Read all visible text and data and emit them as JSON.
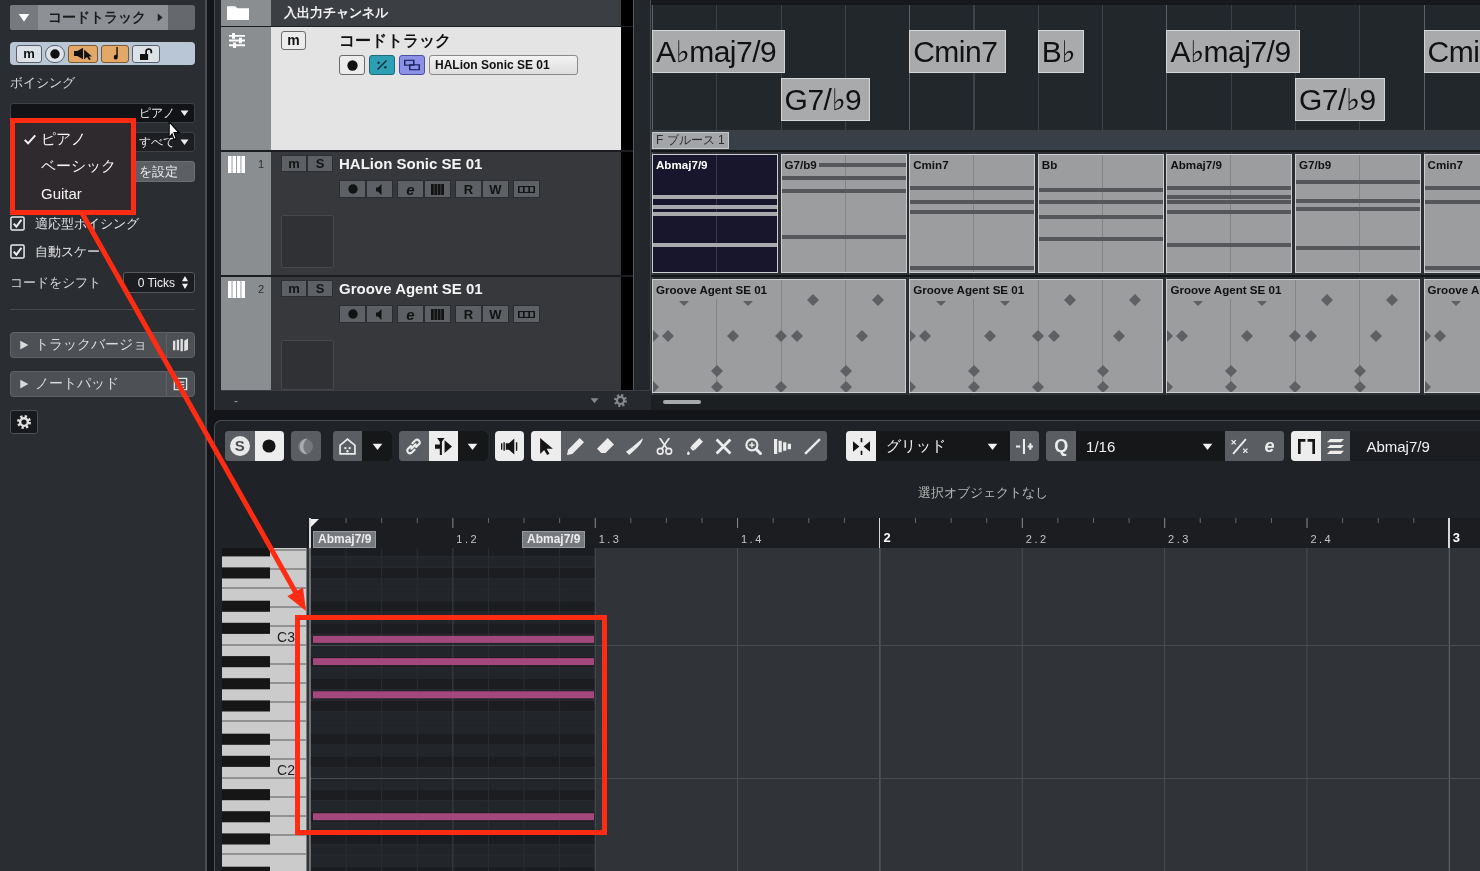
{
  "inspector": {
    "title": "コードトラック",
    "track_buttons": [
      {
        "kind": "mute",
        "label": "m",
        "on": false
      },
      {
        "kind": "record",
        "on": false
      },
      {
        "kind": "monitor",
        "on": true
      },
      {
        "kind": "note",
        "on": true
      },
      {
        "kind": "lock",
        "on": false
      }
    ],
    "voicing_label": "ボイシング",
    "voicing_value": "ピアノ",
    "voicing_menu": [
      {
        "label": "ピアノ",
        "selected": true
      },
      {
        "label": "ベーシック",
        "selected": false
      },
      {
        "label": "Guitar",
        "selected": false
      }
    ],
    "scope_value": "すべて",
    "set_button": "を設定",
    "checkboxes": [
      {
        "label": "適応型ボイシング",
        "checked": true
      },
      {
        "label": "自動スケー",
        "checked": true
      }
    ],
    "shift_label": "コードをシフト",
    "shift_value": "0 Ticks",
    "sections": [
      {
        "kind": "versions",
        "label": "トラックバージョ",
        "expanded": false
      },
      {
        "kind": "notepad",
        "label": "ノートパッド",
        "expanded": false
      }
    ]
  },
  "track_list": {
    "folder": {
      "title": "入出力チャンネル"
    },
    "chord_track": {
      "mute": "m",
      "title": "コードトラック",
      "instrument": "HALion Sonic SE 01",
      "selected": true
    },
    "tracks": [
      {
        "number": "1",
        "mute": "m",
        "solo": "S",
        "title": "HALion Sonic SE 01",
        "edit": "e",
        "read": "R",
        "write": "W"
      },
      {
        "number": "2",
        "mute": "m",
        "solo": "S",
        "title": "Groove Agent SE 01",
        "edit": "e",
        "read": "R",
        "write": "W"
      }
    ],
    "footer": "-"
  },
  "arrange": {
    "chords": [
      {
        "label": "A♭maj7/9"
      },
      {
        "label": "G7/♭9"
      },
      {
        "label": "Cmin7"
      },
      {
        "label": "B♭"
      },
      {
        "label": "A♭maj7/9"
      },
      {
        "label": "G7/♭9"
      },
      {
        "label": "Cmi"
      }
    ],
    "scale": "F ブルース 1",
    "lanes": [
      {
        "kind": "midi",
        "parts": [
          {
            "label": "Abmaj7/9",
            "selected": true
          },
          {
            "label": "G7/b9",
            "selected": false
          },
          {
            "label": "Cmin7",
            "selected": false
          },
          {
            "label": "Bb",
            "selected": false
          },
          {
            "label": "Abmaj7/9",
            "selected": false
          },
          {
            "label": "G7/b9",
            "selected": false
          },
          {
            "label": "Cmin7",
            "selected": false
          }
        ]
      },
      {
        "kind": "drum",
        "parts": [
          {
            "label": "Groove Agent SE 01",
            "selected": false
          },
          {
            "label": "Groove Agent SE 01",
            "selected": false
          },
          {
            "label": "Groove Agent SE 01",
            "selected": false
          },
          {
            "label": "Groove A",
            "selected": false
          }
        ]
      }
    ]
  },
  "editor": {
    "toolbar": [
      {
        "buttons": [
          {
            "kind": "solo",
            "label": "S",
            "on": false
          },
          {
            "kind": "record",
            "on": true
          }
        ]
      },
      {
        "buttons": [
          {
            "kind": "moon",
            "on": false
          }
        ]
      },
      {
        "buttons": [
          {
            "kind": "house",
            "on": false
          },
          {
            "kind": "caret"
          }
        ]
      },
      {
        "buttons": [
          {
            "kind": "link",
            "on": false
          },
          {
            "kind": "split",
            "on": true
          },
          {
            "kind": "caret"
          }
        ]
      },
      {
        "buttons": [
          {
            "kind": "speaker",
            "on": true
          }
        ]
      },
      {
        "buttons": [
          {
            "kind": "pointer",
            "selected": true
          },
          {
            "kind": "pencil",
            "selected": false
          },
          {
            "kind": "eraser",
            "selected": false
          },
          {
            "kind": "knife",
            "selected": false
          },
          {
            "kind": "scissors",
            "selected": false
          },
          {
            "kind": "glue",
            "selected": false
          },
          {
            "kind": "mute",
            "selected": false
          },
          {
            "kind": "zoom",
            "selected": false
          },
          {
            "kind": "comb",
            "selected": false
          },
          {
            "kind": "line",
            "selected": false
          }
        ]
      },
      {
        "buttons": [
          {
            "kind": "snap",
            "on": true
          },
          {
            "kind": "dropdown",
            "value": "グリッド"
          },
          {
            "kind": "offset",
            "on": false
          }
        ]
      },
      {
        "buttons": [
          {
            "kind": "quantize",
            "label": "Q",
            "on": false
          },
          {
            "kind": "dropdown",
            "value": "1/16"
          },
          {
            "kind": "fraction",
            "on": false
          },
          {
            "kind": "edit",
            "label": "e",
            "on": false
          }
        ]
      },
      {
        "buttons": [
          {
            "kind": "bracket",
            "on": true
          },
          {
            "kind": "layers",
            "on": false
          },
          {
            "kind": "readout",
            "value": "Abmaj7/9"
          }
        ]
      }
    ],
    "status": "選択オブジェクトなし",
    "ruler": {
      "markers": [
        {
          "kind": "beat",
          "label": "1.2"
        },
        {
          "kind": "beat",
          "label": "1.3"
        },
        {
          "kind": "beat",
          "label": "1.4"
        },
        {
          "kind": "bar",
          "label": "2"
        },
        {
          "kind": "beat",
          "label": "2.2"
        },
        {
          "kind": "beat",
          "label": "2.3"
        },
        {
          "kind": "beat",
          "label": "2.4"
        },
        {
          "kind": "bar",
          "label": "3"
        }
      ],
      "chords": [
        "Abmaj7/9",
        "Abmaj7/9"
      ]
    },
    "keyboard": [
      "C3",
      "C2"
    ]
  },
  "callouts": [
    {
      "kind": "frame"
    },
    {
      "kind": "frame"
    },
    {
      "kind": "arrow"
    }
  ]
}
